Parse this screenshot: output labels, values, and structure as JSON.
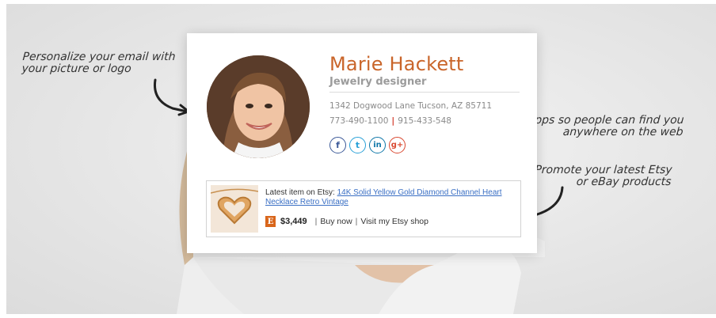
{
  "annotations": {
    "picture_line1": "Personalize your email with",
    "picture_line2": "your picture or logo",
    "social_line1": "Add social apps so people can find you",
    "social_line2": "anywhere on the web",
    "etsy_line1": "Promote your latest Etsy",
    "etsy_line2": "or eBay products"
  },
  "signature": {
    "name": "Marie Hackett",
    "title": "Jewelry designer",
    "address": "1342 Dogwood Lane Tucson, AZ 85711",
    "phone1": "773-490-1100",
    "phone_separator": "|",
    "phone2": "915-433-548",
    "socials": [
      {
        "icon": "facebook-icon",
        "glyph": "f"
      },
      {
        "icon": "twitter-icon",
        "glyph": "t"
      },
      {
        "icon": "linkedin-icon",
        "glyph": "in"
      },
      {
        "icon": "google-plus-icon",
        "glyph": "g+"
      }
    ]
  },
  "product": {
    "prefix": "Latest item on Etsy: ",
    "link_text": "14K Solid Yellow Gold Diamond Channel Heart Necklace  Retro Vintage",
    "etsy_logo_letter": "E",
    "price": "$3,449",
    "sep": "|",
    "buy_now": "Buy now",
    "visit_shop": "Visit my Etsy shop"
  },
  "colors": {
    "name": "#c9652a",
    "accent_separator": "#d23a2a",
    "facebook": "#3b5998",
    "twitter": "#2aa1d8",
    "linkedin": "#0e76a8",
    "google_plus": "#d9472f",
    "etsy": "#d9661b",
    "link": "#3a6fc4"
  }
}
